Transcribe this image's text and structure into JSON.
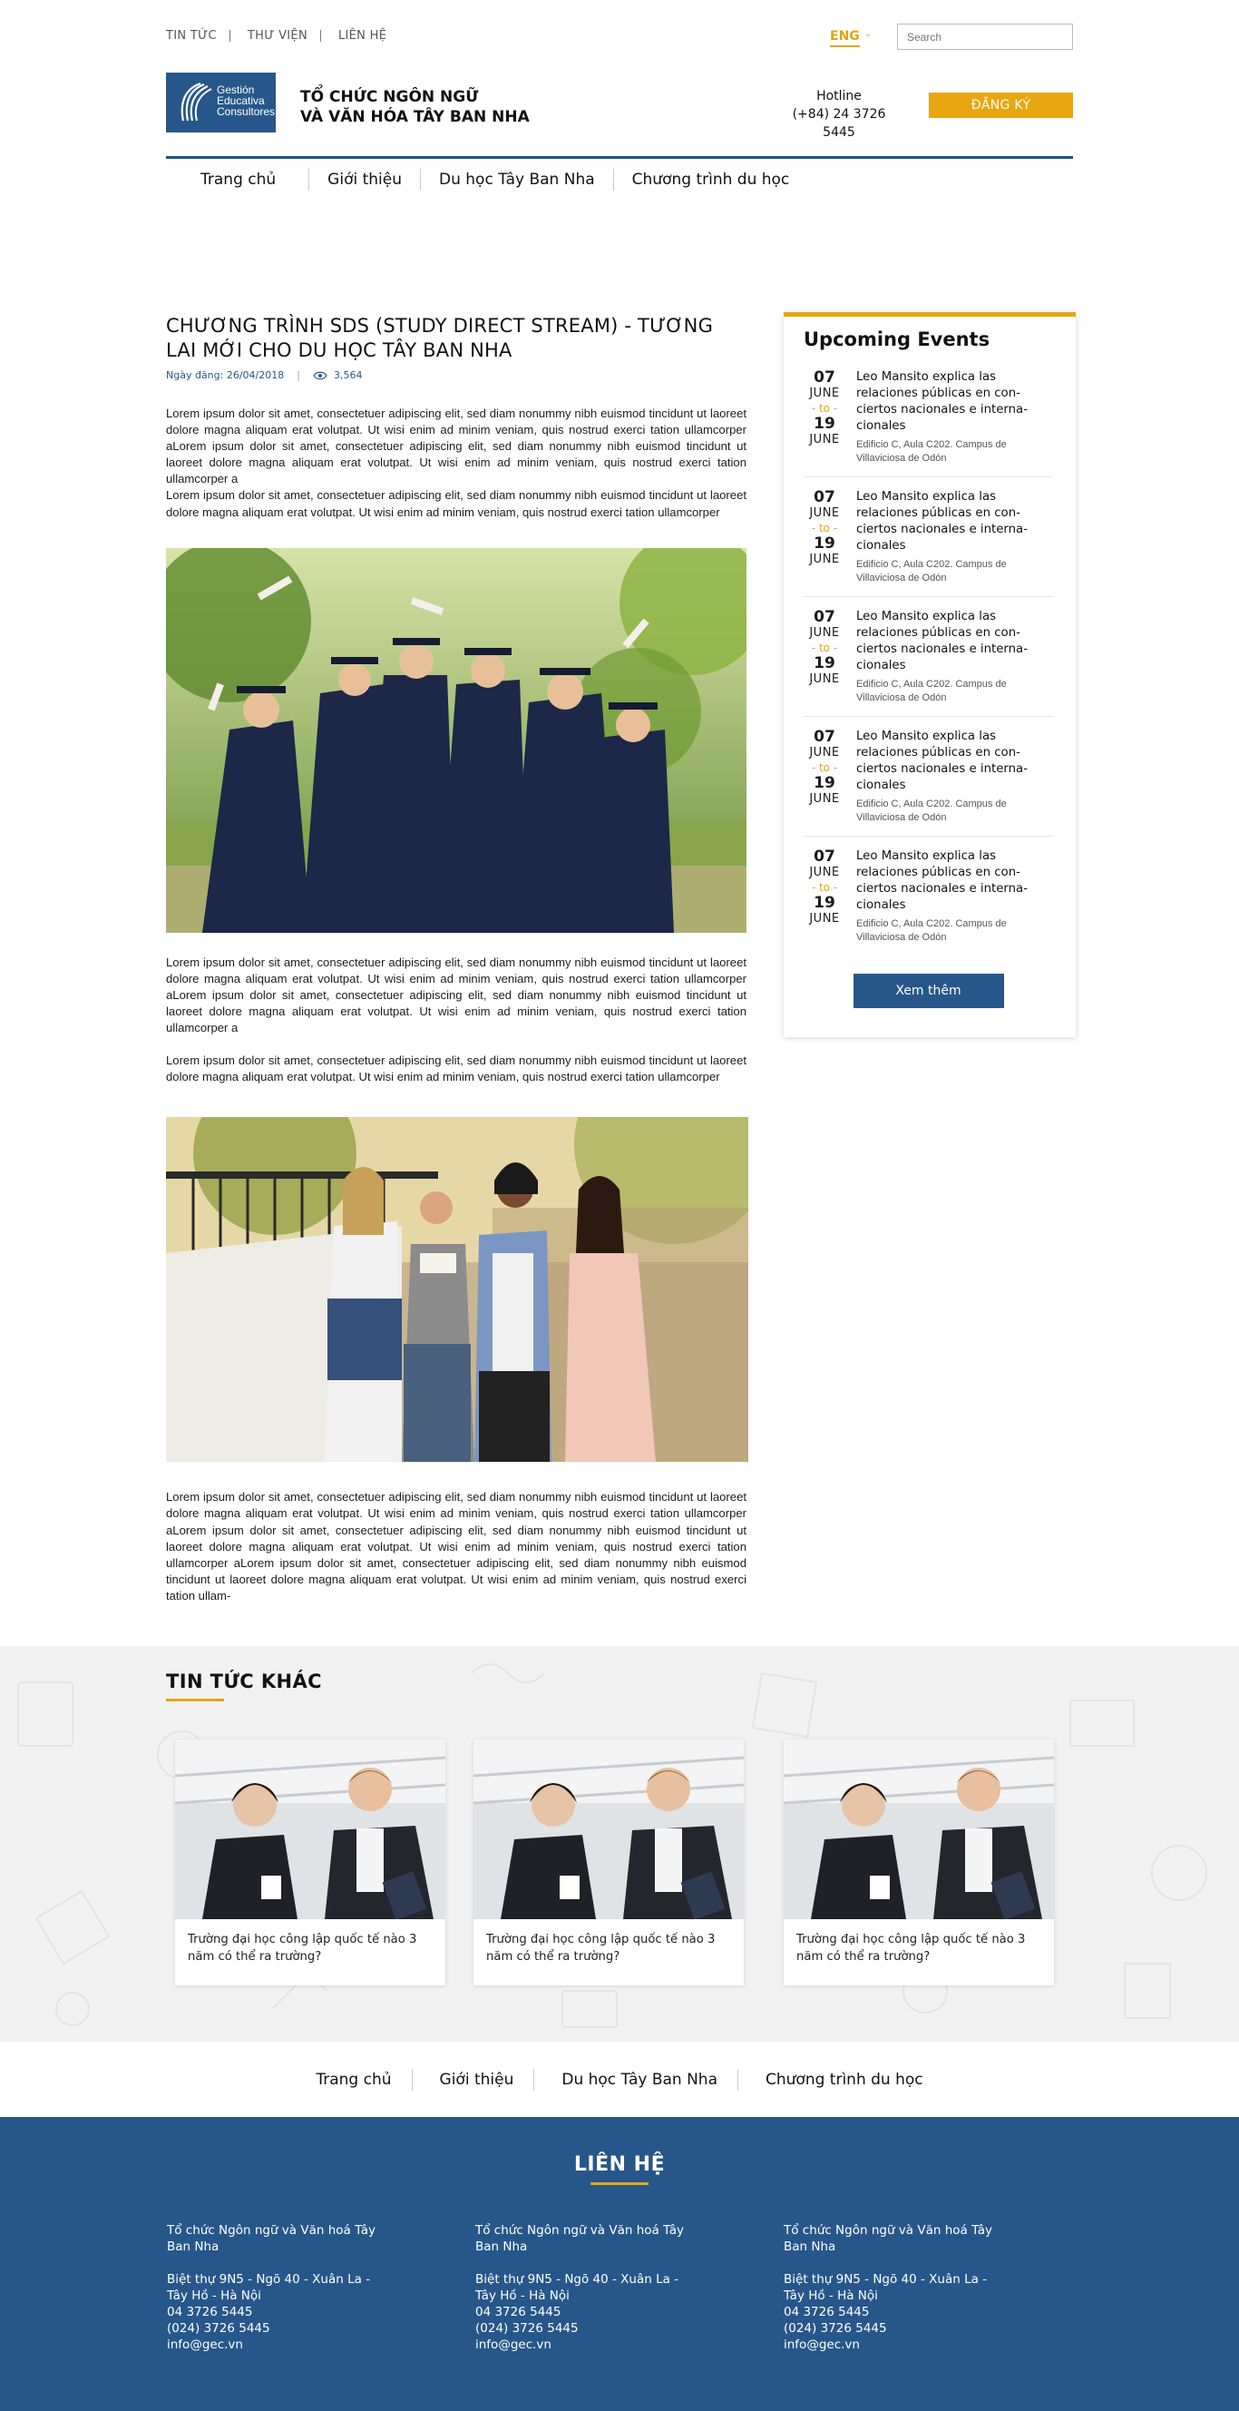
{
  "topnav": {
    "items": [
      "TIN TỨC",
      "THƯ VIỆN",
      "LIÊN HỆ"
    ]
  },
  "lang": {
    "current": "ENG"
  },
  "search": {
    "placeholder": "Search"
  },
  "brand": {
    "logo_lines": [
      "Gestión",
      "Educativa",
      "Consultores"
    ],
    "org_line1": "TỔ CHỨC NGÔN NGỮ",
    "org_line2": "VÀ VĂN HÓA TÂY BAN NHA",
    "hotline_label": "Hotline",
    "hotline_number": "(+84) 24 3726 5445",
    "register": "ĐĂNG KÝ"
  },
  "nav": [
    "Trang chủ",
    "Giới thiệu",
    "Du học Tây Ban Nha",
    "Chương trình du học"
  ],
  "article": {
    "title": "CHƯƠNG TRÌNH SDS (STUDY DIRECT STREAM) - TƯƠNG LAI MỚI CHO DU HỌC TÂY BAN NHA",
    "date": "Ngày đăng: 26/04/2018",
    "views": "3,564",
    "p1": "Lorem ipsum dolor sit amet, consectetuer adipiscing elit, sed diam nonummy nibh euismod tincidunt ut laoreet dolore magna aliquam erat volutpat. Ut wisi enim ad minim veniam, quis nostrud exerci tation ullamcorper aLorem ipsum dolor sit amet, consectetuer adipiscing elit, sed diam nonummy nibh euismod tincidunt ut laoreet dolore magna aliquam erat volutpat. Ut wisi enim ad minim veniam, quis nostrud exerci tation ullamcorper a",
    "p2": "Lorem ipsum dolor sit amet, consectetuer adipiscing elit, sed diam nonummy nibh euismod tincidunt ut laoreet dolore magna aliquam erat volutpat. Ut wisi enim ad minim veniam, quis nostrud exerci tation ullamcorper",
    "p3": "Lorem ipsum dolor sit amet, consectetuer adipiscing elit, sed diam nonummy nibh euismod tincidunt ut laoreet dolore magna aliquam erat volutpat. Ut wisi enim ad minim veniam, quis nostrud exerci tation ullamcorper aLorem ipsum dolor sit amet, consectetuer adipiscing elit, sed diam nonummy nibh euismod tincidunt ut laoreet dolore magna aliquam erat volutpat. Ut wisi enim ad minim veniam, quis nostrud exerci tation ullamcorper a",
    "p4": "Lorem ipsum dolor sit amet, consectetuer adipiscing elit, sed diam nonummy nibh euismod tincidunt ut laoreet dolore magna aliquam erat volutpat. Ut wisi enim ad minim veniam, quis nostrud exerci tation ullamcorper",
    "p5": "Lorem ipsum dolor sit amet, consectetuer adipiscing elit, sed diam nonummy nibh euismod tincidunt ut laoreet dolore magna aliquam erat volutpat. Ut wisi enim ad minim veniam, quis nostrud exerci tation ullamcorper aLorem ipsum dolor sit amet, consectetuer adipiscing elit, sed diam nonummy nibh euismod tincidunt ut laoreet dolore magna aliquam erat volutpat. Ut wisi enim ad minim veniam, quis nostrud exerci tation ullamcorper aLorem ipsum dolor sit amet, consectetuer adipiscing elit, sed diam nonummy nibh euismod tincidunt ut laoreet dolore magna aliquam erat volutpat. Ut wisi enim ad minim veniam, quis nostrud exerci tation ullam-"
  },
  "sidebar": {
    "title": "Upcoming Events",
    "more": "Xem thêm",
    "events": [
      {
        "day1": "07",
        "month1": "JUNE",
        "to": "- to -",
        "day2": "19",
        "month2": "JUNE",
        "title": "Leo Mansito explica las relaciones públicas en con-ciertos nacionales e interna-cionales",
        "location": "Edificio C, Aula C202. Campus de Villaviciosa de Odón"
      },
      {
        "day1": "07",
        "month1": "JUNE",
        "to": "- to -",
        "day2": "19",
        "month2": "JUNE",
        "title": "Leo Mansito explica las relaciones públicas en con-ciertos nacionales e interna-cionales",
        "location": "Edificio C, Aula C202. Campus de Villaviciosa de Odón"
      },
      {
        "day1": "07",
        "month1": "JUNE",
        "to": "- to -",
        "day2": "19",
        "month2": "JUNE",
        "title": "Leo Mansito explica las relaciones públicas en con-ciertos nacionales e interna-cionales",
        "location": "Edificio C, Aula C202. Campus de Villaviciosa de Odón"
      },
      {
        "day1": "07",
        "month1": "JUNE",
        "to": "- to -",
        "day2": "19",
        "month2": "JUNE",
        "title": "Leo Mansito explica las relaciones públicas en con-ciertos nacionales e interna-cionales",
        "location": "Edificio C, Aula C202. Campus de Villaviciosa de Odón"
      },
      {
        "day1": "07",
        "month1": "JUNE",
        "to": "- to -",
        "day2": "19",
        "month2": "JUNE",
        "title": "Leo Mansito explica las relaciones públicas en con-ciertos nacionales e interna-cionales",
        "location": "Edificio C, Aula C202. Campus de Villaviciosa de Odón"
      }
    ]
  },
  "other_news": {
    "title": "TIN TỨC KHÁC",
    "cards": [
      {
        "text": "Trường đại học công lập quốc tế nào 3 năm có thể ra trường?"
      },
      {
        "text": "Trường đại học công lập quốc tế nào 3 năm có thể ra trường?"
      },
      {
        "text": "Trường đại học công lập quốc tế nào 3 năm có thể ra trường?"
      }
    ]
  },
  "footer_nav": [
    "Trang chủ",
    "Giới thiệu",
    "Du học Tây Ban Nha",
    "Chương trình du học"
  ],
  "contact": {
    "title": "LIÊN HỆ",
    "columns": [
      {
        "org": "Tổ chức Ngôn ngữ và Văn hoá Tây Ban Nha",
        "address": "Biệt thự 9N5 - Ngõ 40 - Xuân La - Tây Hồ - Hà Nội",
        "phone": "04 3726 5445",
        "phone2": "(024) 3726 5445",
        "email": "info@gec.vn"
      },
      {
        "org": "Tổ chức Ngôn ngữ và Văn hoá Tây Ban Nha",
        "address": "Biệt thự 9N5 - Ngõ 40 - Xuân La - Tây Hồ - Hà Nội",
        "phone": "04 3726 5445",
        "phone2": "(024) 3726 5445",
        "email": "info@gec.vn"
      },
      {
        "org": "Tổ chức Ngôn ngữ và Văn hoá Tây Ban Nha",
        "address": "Biệt thự 9N5 - Ngõ 40 - Xuân La - Tây Hồ - Hà Nội",
        "phone": "04 3726 5445",
        "phone2": "(024) 3726 5445",
        "email": "info@gec.vn"
      }
    ]
  },
  "colors": {
    "primary": "#27578a",
    "accent": "#e8a611"
  }
}
